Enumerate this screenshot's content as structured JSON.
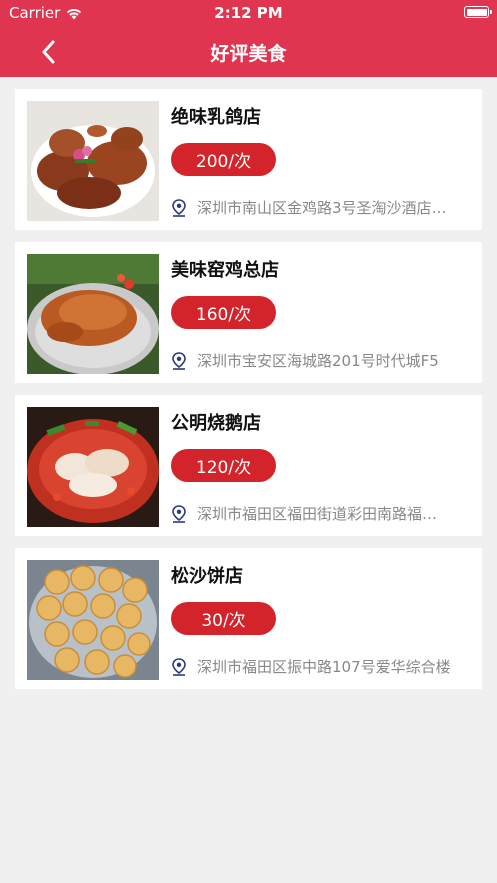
{
  "status_bar": {
    "carrier": "Carrier",
    "time": "2:12 PM",
    "battery_level": 1.0
  },
  "nav": {
    "title": "好评美食",
    "back_icon": "chevron-left-icon"
  },
  "colors": {
    "header": "#df3550",
    "price_badge": "#d3242b",
    "address_text": "#888888",
    "pin": "#2b3a7a"
  },
  "restaurants": [
    {
      "name": "绝味乳鸽店",
      "price": "200/次",
      "address": "深圳市南山区金鸡路3号圣淘沙酒店…",
      "image": "roast-pigeon"
    },
    {
      "name": "美味窑鸡总店",
      "price": "160/次",
      "address": "深圳市宝安区海城路201号时代城F5",
      "image": "roast-chicken"
    },
    {
      "name": "公明烧鹅店",
      "price": "120/次",
      "address": "深圳市福田区福田街道彩田南路福…",
      "image": "roast-goose-dish"
    },
    {
      "name": "松沙饼店",
      "price": "30/次",
      "address": "深圳市福田区振中路107号爱华综合楼",
      "image": "pastry-cookies"
    }
  ]
}
